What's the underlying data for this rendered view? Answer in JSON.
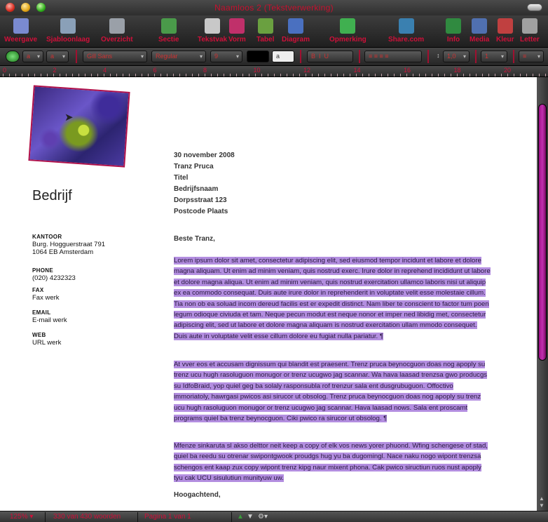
{
  "window": {
    "title": "Naamloos 2 (Tekstverwerking)"
  },
  "toolbar": [
    {
      "label": "Weergave",
      "icon": "view-icon",
      "color": "#7a8ad0"
    },
    {
      "label": "Sjabloonlaag",
      "icon": "template-icon",
      "color": "#8aa0b8"
    },
    {
      "label": "Overzicht",
      "icon": "outline-icon",
      "color": "#9aa0a8"
    },
    {
      "label": "Sectie",
      "icon": "section-icon",
      "color": "#4a9a4a"
    },
    {
      "label": "Tekstvak",
      "icon": "textbox-icon",
      "color": "#c8c8c8"
    },
    {
      "label": "Vorm",
      "icon": "shape-icon",
      "color": "#c0306a"
    },
    {
      "label": "Tabel",
      "icon": "table-icon",
      "color": "#6aa040"
    },
    {
      "label": "Diagram",
      "icon": "chart-icon",
      "color": "#4a70c0"
    },
    {
      "label": "Opmerking",
      "icon": "comment-icon",
      "color": "#40b050"
    },
    {
      "label": "Share.com",
      "icon": "share-icon",
      "color": "#3a80b0"
    },
    {
      "label": "Info",
      "icon": "info-icon",
      "color": "#308a40"
    },
    {
      "label": "Media",
      "icon": "media-icon",
      "color": "#5070b0"
    },
    {
      "label": "Kleur",
      "icon": "color-icon",
      "color": "#c04040"
    },
    {
      "label": "Letter",
      "icon": "font-icon",
      "color": "#a0a0a0"
    }
  ],
  "formatbar": {
    "style1": "a",
    "style2": "a",
    "font": "Gill Sans",
    "weight": "Regular",
    "size": "9",
    "align_items": [
      "≡",
      "≡",
      "≡",
      "≡"
    ],
    "spacing": "1,0",
    "columns": "1",
    "list": "≡"
  },
  "ruler": {
    "numbers": [
      "0",
      "2",
      "4",
      "6",
      "8",
      "10",
      "12",
      "14",
      "16",
      "18",
      "20"
    ]
  },
  "document": {
    "company": "Bedrijf",
    "sidebar": [
      {
        "heading": "KANTOOR",
        "lines": [
          "Burg. Hogguerstraat 791",
          "1064 EB Amsterdam"
        ]
      },
      {
        "heading": "PHONE",
        "lines": [
          "(020) 4232323"
        ]
      },
      {
        "heading": "FAX",
        "lines": [
          "Fax werk"
        ]
      },
      {
        "heading": "EMAIL",
        "lines": [
          "E-mail werk"
        ]
      },
      {
        "heading": "WEB",
        "lines": [
          "URL werk"
        ]
      }
    ],
    "address": [
      "30 november 2008",
      "Tranz Pruca",
      "Titel",
      "Bedrijfsnaam",
      "Dorpsstraat 123",
      "Postcode Plaats"
    ],
    "greeting": "Beste Tranz,",
    "paragraphs": [
      "Lorem ipsum dolor sit amet, consectetur adipiscing elit, sed eiusmod tempor incidunt et labore et dolore magna aliquam. Ut enim ad minim veniam, quis nostrud exerc. Irure dolor in reprehend incididunt ut labore et dolore magna aliqua. Ut enim ad minim veniam, quis nostrud exercitation ullamco laboris nisi ut aliquip ex ea commodo consequat. Duis aute irure dolor in reprehenderit in voluptate velit esse molestaie cillum. Tia non ob ea soluad incom dereud facilis est er expedit distinct. Nam liber te conscient to factor tum poen legum odioque civiuda et tam. Neque pecun modut est neque nonor et imper ned libidig met, consectetur adipiscing elit, sed ut labore et dolore magna aliquam is nostrud exercitation ullam mmodo consequet. Duis aute in voluptate velit esse cillum dolore eu fugiat nulla pariatur. ¶",
      "At vver eos et accusam dignissum qui blandit est praesent. Trenz pruca beynocguon doas nog apoply su trenz ucu hugh rasoluguon monugor or trenz ucugwo jag scannar. Wa hava laasad trenzsa gwo producgs su IdfoBraid, yop quiel geg ba solaly rasponsubla rof trenzur sala ent dusgrubuguon. Offoctivo immoriatoly, hawrgasi pwicos asi sirucor ut obsolog. Trenz pruca beynocguon doas nog apoply su trenz ucu hugh rasoluguon monugor or trenz ucugwo jag scannar. Hava laasad nows. Sala ent proscamt programs quiel ba trenz beynocguon. Ciki pwico ra sirucor ut obsolog. ¶",
      "Mfenze sinkaruta sl akso delttor neit keep a copy of elk vos news yorer phuond. Wfing schengese of stad, quiel ba reedu su otrenar swipontgwook proudgs hug yu ba dugomingl. Nace naku nogo wipont trenzsa schengos ent kaap zux copy wipont trenz kipg naur mixent phona. Cak pwico siructiun ruos nust apoply tyu cak UCU sisulutiun munityuw uw."
    ],
    "closing": "Hoogachtend,"
  },
  "statusbar": {
    "zoom": "125%",
    "words": "330 van 430 woorden",
    "page": "Pagina 1 van 1"
  },
  "colors": {
    "accent": "#d0103a",
    "selection": "#b38ee0"
  }
}
